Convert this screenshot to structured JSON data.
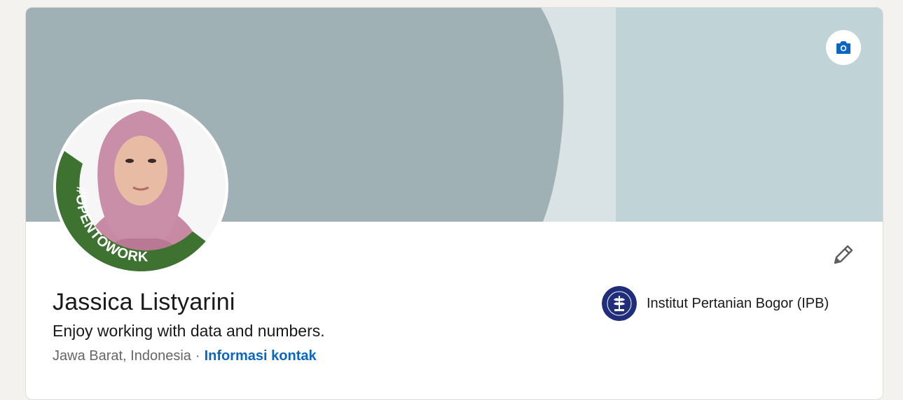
{
  "profile": {
    "name": "Jassica Listyarini",
    "headline": "Enjoy working with data and numbers.",
    "location": "Jawa Barat, Indonesia",
    "separator": "·",
    "contact_link": "Informasi kontak",
    "open_to_work_badge": "#OPENTOWORK"
  },
  "education": {
    "school": "Institut Pertanian Bogor (IPB)",
    "logo_icon": "ipb-logo-icon"
  },
  "actions": {
    "edit_cover_icon": "camera-icon",
    "edit_profile_icon": "pencil-icon"
  },
  "colors": {
    "cover_dark": "#a0b1b5",
    "cover_light": "#c0d3d7",
    "cover_stripe": "#d9e3e5",
    "link": "#0a66c2",
    "open_to_work_green": "#3d7230",
    "ipb_navy": "#1f2d7a"
  }
}
